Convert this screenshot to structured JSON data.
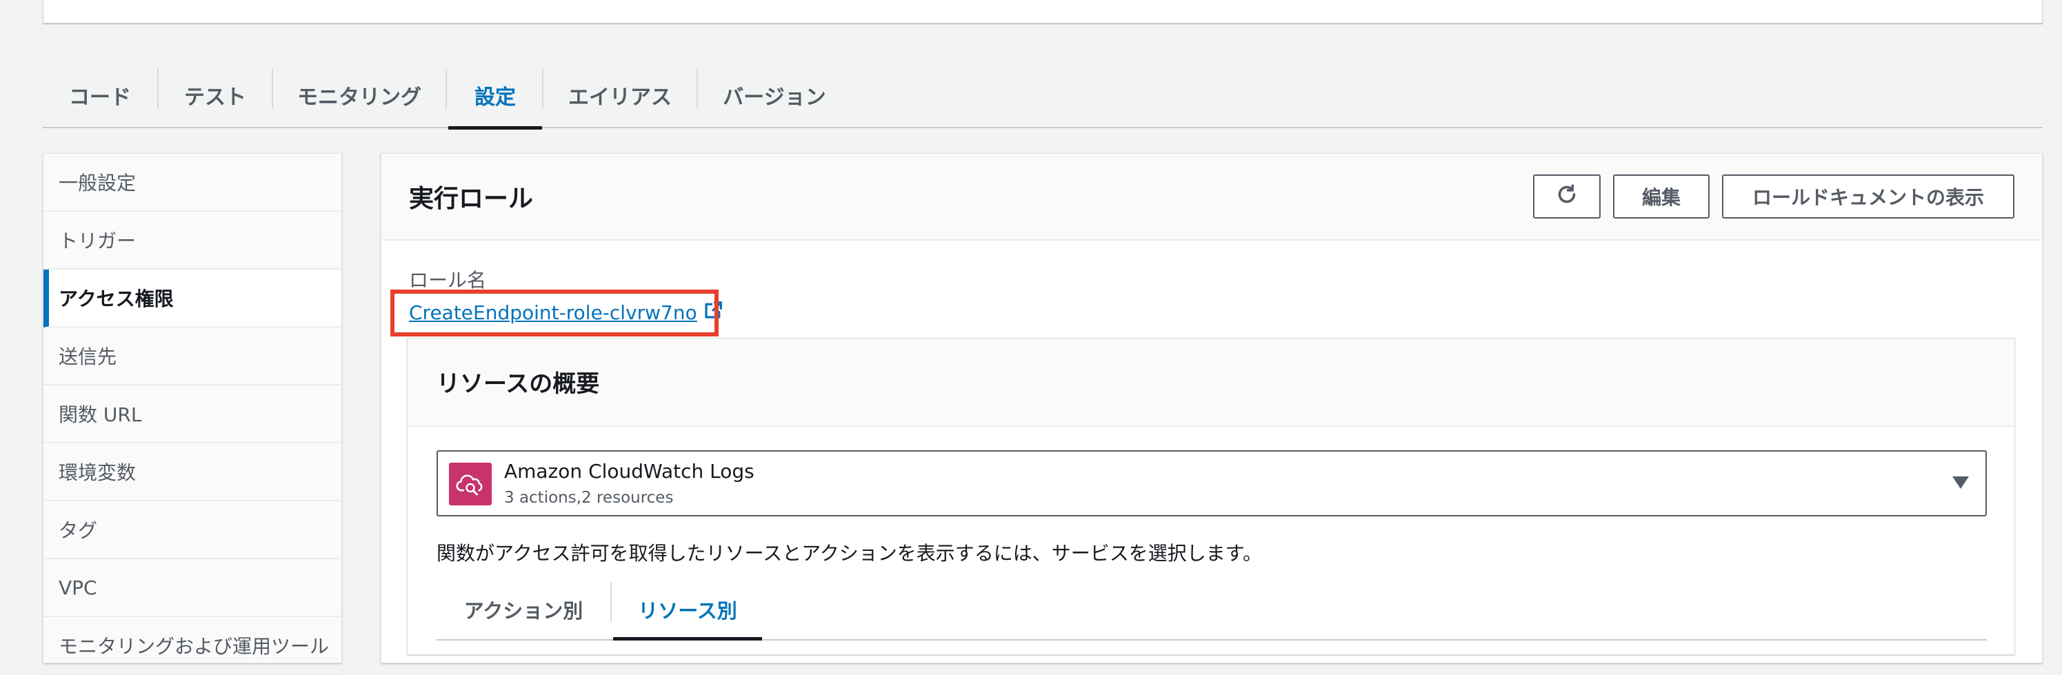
{
  "tabs": [
    {
      "label": "コード"
    },
    {
      "label": "テスト"
    },
    {
      "label": "モニタリング"
    },
    {
      "label": "設定"
    },
    {
      "label": "エイリアス"
    },
    {
      "label": "バージョン"
    }
  ],
  "active_tab": "設定",
  "sidenav": {
    "items": [
      {
        "label": "一般設定"
      },
      {
        "label": "トリガー"
      },
      {
        "label": "アクセス権限"
      },
      {
        "label": "送信先"
      },
      {
        "label": "関数 URL"
      },
      {
        "label": "環境変数"
      },
      {
        "label": "タグ"
      },
      {
        "label": "VPC"
      },
      {
        "label": "モニタリングおよび運用ツール"
      }
    ],
    "active": "アクセス権限"
  },
  "main": {
    "title": "実行ロール",
    "buttons": {
      "refresh_icon": "refresh-icon",
      "edit": "編集",
      "view_role_doc": "ロールドキュメントの表示"
    },
    "role_label": "ロール名",
    "role_link": "CreateEndpoint-role-clvrw7no",
    "role_link_icon": "external-link-icon",
    "highlight_color": "#e8402b"
  },
  "resource_summary": {
    "title": "リソースの概要",
    "service": {
      "icon": "cloudwatch-logs-icon",
      "icon_color": "#c7336a",
      "name": "Amazon CloudWatch Logs",
      "sub": "3 actions,2 resources"
    },
    "description": "関数がアクセス許可を取得したリソースとアクションを表示するには、サービスを選択します。",
    "subtabs": [
      {
        "label": "アクション別"
      },
      {
        "label": "リソース別"
      }
    ],
    "active_subtab": "リソース別"
  },
  "colors": {
    "accent": "#0073bb",
    "background": "#f2f3f3"
  }
}
